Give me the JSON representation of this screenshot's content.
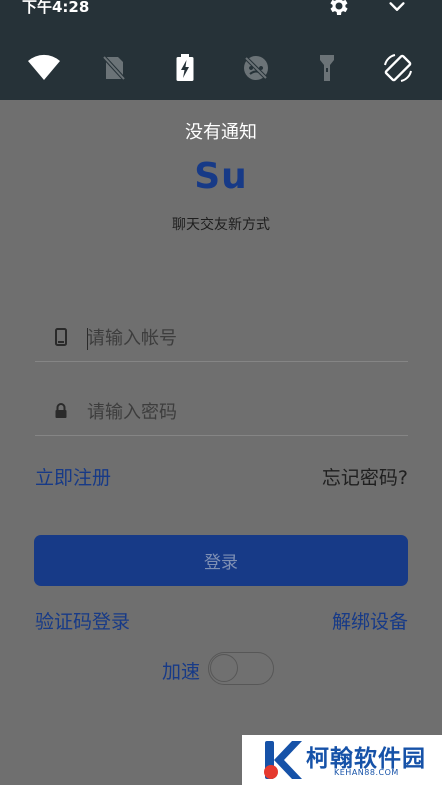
{
  "status_bar": {
    "time": "下午4:28",
    "icons": [
      "settings-gear-icon",
      "chevron-down-icon"
    ]
  },
  "quick_settings": {
    "tiles": [
      {
        "name": "wifi-icon",
        "state": "on"
      },
      {
        "name": "no-sim-icon",
        "state": "off"
      },
      {
        "name": "battery-saver-icon",
        "state": "on"
      },
      {
        "name": "data-saver-off-icon",
        "state": "off"
      },
      {
        "name": "flashlight-icon",
        "state": "off"
      },
      {
        "name": "auto-rotate-icon",
        "state": "on"
      }
    ]
  },
  "notifications": {
    "empty_text": "没有通知"
  },
  "app": {
    "logo_text": "Su",
    "slogan": "聊天交友新方式"
  },
  "login_form": {
    "account_placeholder": "请输入帐号",
    "password_placeholder": "请输入密码",
    "account_value": "",
    "password_value": ""
  },
  "links": {
    "register": "立即注册",
    "forgot_password": "忘记密码?",
    "code_login": "验证码登录",
    "unbind_device": "解绑设备"
  },
  "buttons": {
    "login": "登录"
  },
  "accelerate": {
    "label": "加速",
    "enabled": false
  },
  "watermark": {
    "title": "柯翰软件园",
    "url": "KEHAN88.COM"
  },
  "colors": {
    "shade": "#263238",
    "scrim": "#6f6f6f",
    "brand": "#173a87"
  }
}
